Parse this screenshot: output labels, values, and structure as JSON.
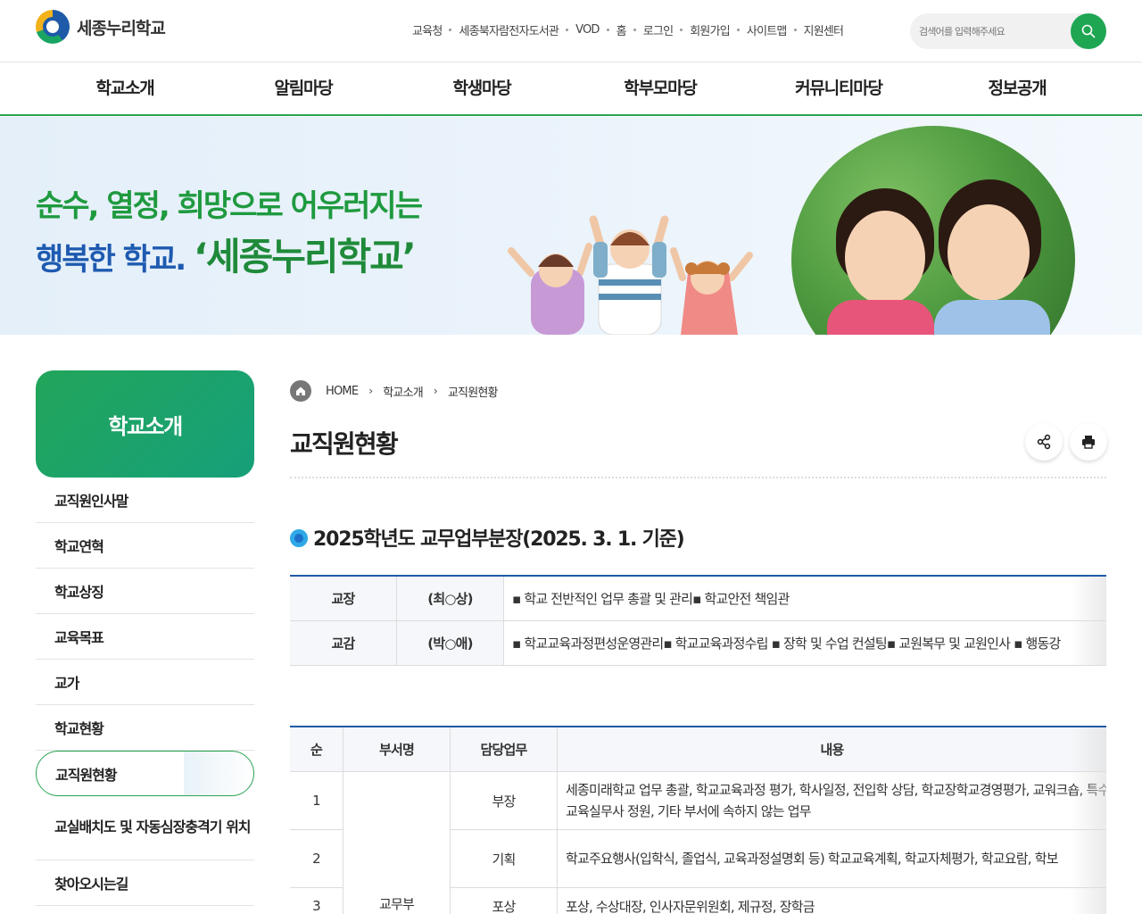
{
  "header": {
    "logo_text": "세종누리학교",
    "util_links": [
      "교육청",
      "세종북자람전자도서관",
      "VOD",
      "홈",
      "로그인",
      "회원가입",
      "사이트맵",
      "지원센터"
    ],
    "search_placeholder": "검색어를 입력해주세요"
  },
  "gnb": [
    "학교소개",
    "알림마당",
    "학생마당",
    "학부모마당",
    "커뮤니티마당",
    "정보공개"
  ],
  "banner": {
    "line1": "순수, 열정, 희망으로 어우러지는",
    "line2_a": "행복한 학교.",
    "line2_b": "‘세종누리학교’"
  },
  "lnb": {
    "title": "학교소개",
    "items": [
      "교직원인사말",
      "학교연혁",
      "학교상징",
      "교육목표",
      "교가",
      "학교현황",
      "교직원현황",
      "교실배치도 및 자동심장충격기 위치",
      "찾아오시는길"
    ],
    "active_index": 6
  },
  "breadcrumb": [
    "HOME",
    "학교소개",
    "교직원현황"
  ],
  "page_title": "교직원현황",
  "section_title": "2025학년도 교무업부분장(2025. 3. 1. 기준)",
  "table1": [
    {
      "role": "교장",
      "name": "(최○상)",
      "content": "▪ 학교 전반적인 업무 총괄 및 관리▪ 학교안전 책임관"
    },
    {
      "role": "교감",
      "name": "(박○애)",
      "content": "▪ 학교교육과정편성운영관리▪ 학교교육과정수립 ▪ 장학 및 수업 컨설팅▪ 교원복무 및 교원인사 ▪ 행동강"
    }
  ],
  "table2": {
    "headers": [
      "순",
      "부서명",
      "담당업무",
      "내용"
    ],
    "dept": "교무부",
    "rows": [
      {
        "no": "1",
        "duty": "부장",
        "content": "세종미래학교 업무 총괄, 학교교육과정 평가, 학사일정, 전입학 상담, 학교장학교경영평가, 교워크숍, 특수교육실무사 정원, 기타 부서에 속하지 않는 업무"
      },
      {
        "no": "2",
        "duty": "기획",
        "content": "학교주요행사(입학식, 졸업식, 교육과정설명회 등) 학교교육계획, 학교자체평가, 학교요람, 학보"
      },
      {
        "no": "3",
        "duty": "포상",
        "content": "포상, 수상대장, 인사자문위원회, 제규정, 장학금"
      }
    ]
  }
}
